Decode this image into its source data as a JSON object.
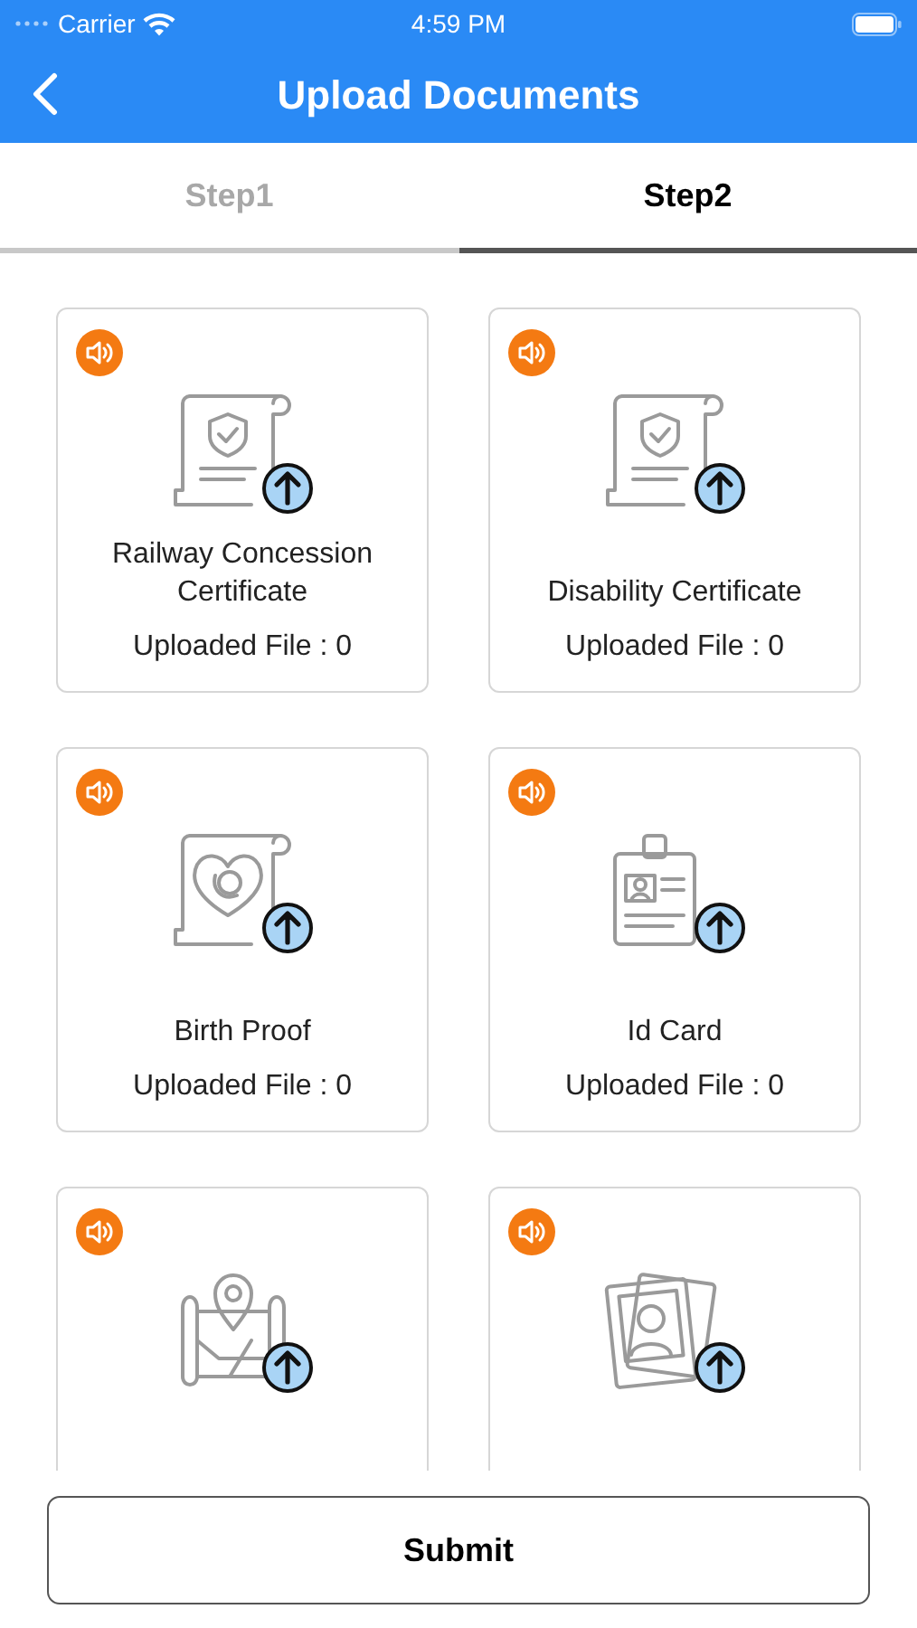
{
  "status_bar": {
    "carrier": "Carrier",
    "time": "4:59 PM"
  },
  "nav": {
    "title": "Upload Documents"
  },
  "tabs": [
    {
      "label": "Step1",
      "selected": false
    },
    {
      "label": "Step2",
      "selected": true
    }
  ],
  "documents": [
    {
      "kind": "certificate",
      "title": "Railway Concession Certificate",
      "count": "Uploaded File : 0"
    },
    {
      "kind": "certificate",
      "title": "Disability Certificate",
      "count": "Uploaded File : 0"
    },
    {
      "kind": "birth",
      "title": "Birth Proof",
      "count": "Uploaded File : 0"
    },
    {
      "kind": "idcard",
      "title": "Id Card",
      "count": "Uploaded File : 0"
    },
    {
      "kind": "map"
    },
    {
      "kind": "photo"
    }
  ],
  "submit": {
    "label": "Submit"
  }
}
